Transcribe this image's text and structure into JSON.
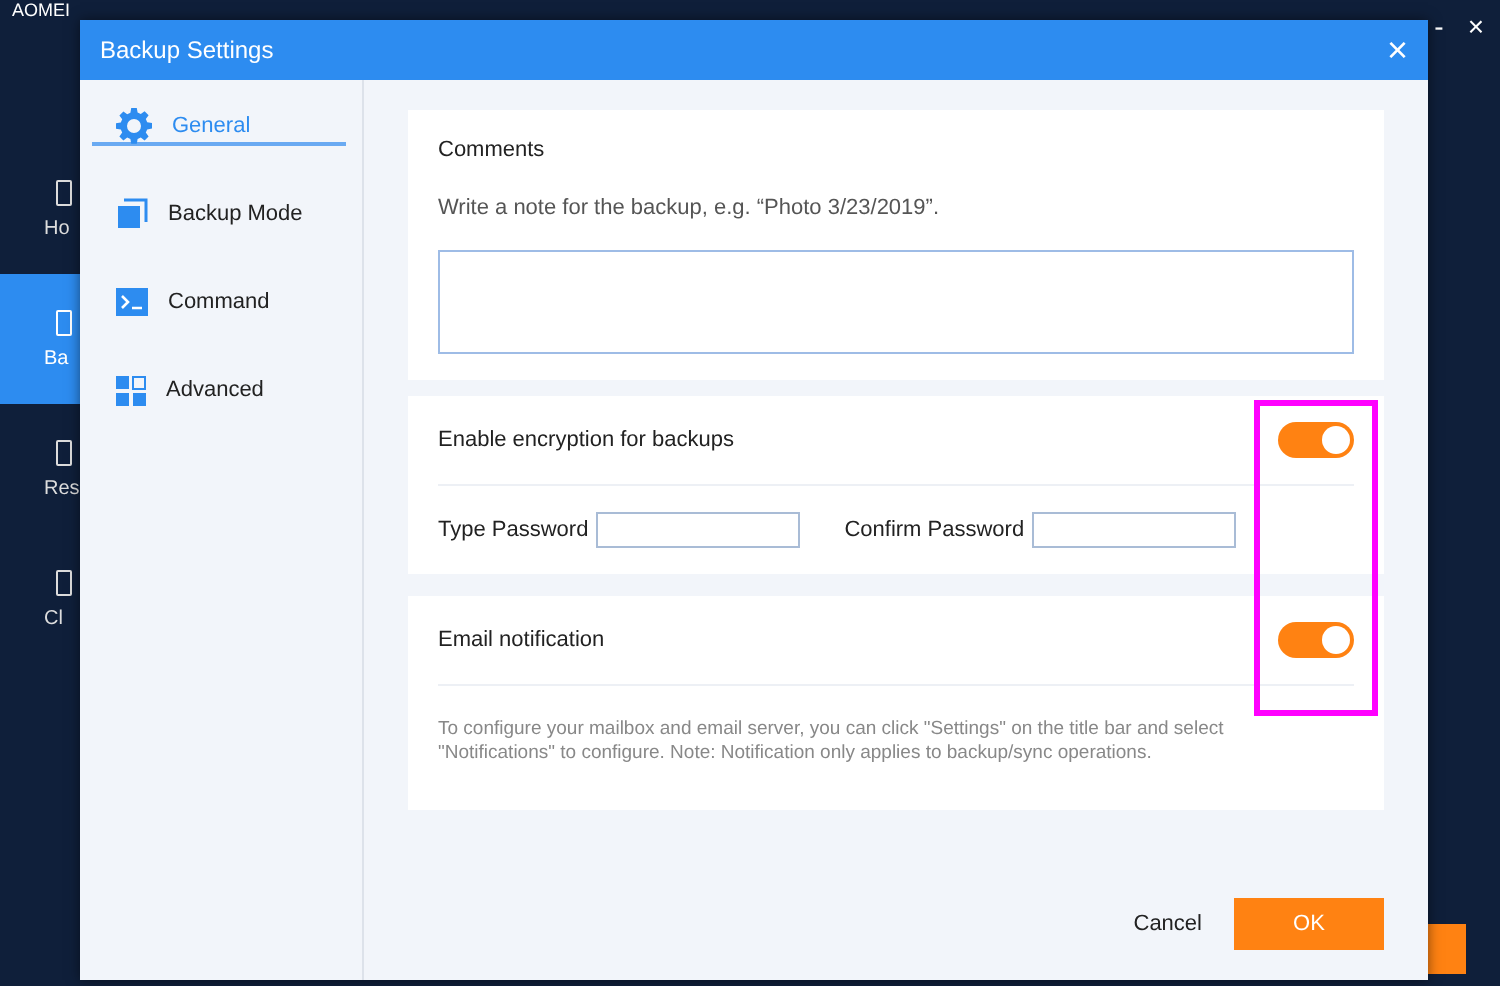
{
  "app": {
    "title": "AOMEI",
    "window_controls": [
      "-",
      "×"
    ],
    "nav": [
      {
        "label": "Ho",
        "selected": false
      },
      {
        "label": "Ba",
        "selected": true
      },
      {
        "label": "Res",
        "selected": false
      },
      {
        "label": "Cl",
        "selected": false
      }
    ]
  },
  "dialog": {
    "title": "Backup Settings",
    "close": "×",
    "nav": [
      {
        "label": "General",
        "kind": "gear",
        "selected": true
      },
      {
        "label": "Backup Mode",
        "kind": "squares",
        "selected": false
      },
      {
        "label": "Command",
        "kind": "terminal",
        "selected": false
      },
      {
        "label": "Advanced",
        "kind": "grid",
        "selected": false
      }
    ],
    "comments": {
      "heading": "Comments",
      "hint": "Write a note for the backup, e.g. “Photo 3/23/2019”."
    },
    "encryption": {
      "label": "Enable encryption for backups",
      "on": true,
      "fields": [
        {
          "label": "Type Password"
        },
        {
          "label": "Confirm Password"
        }
      ]
    },
    "email": {
      "label": "Email notification",
      "on": true,
      "note": "To configure your mailbox and email server, you can click \"Settings\" on the title bar and select \"Notifications\" to configure. Note: Notification only applies to backup/sync operations."
    },
    "buttons": [
      {
        "label": "Cancel",
        "kind": "text"
      },
      {
        "label": "OK",
        "kind": "primary"
      }
    ]
  },
  "highlight_frame": true
}
